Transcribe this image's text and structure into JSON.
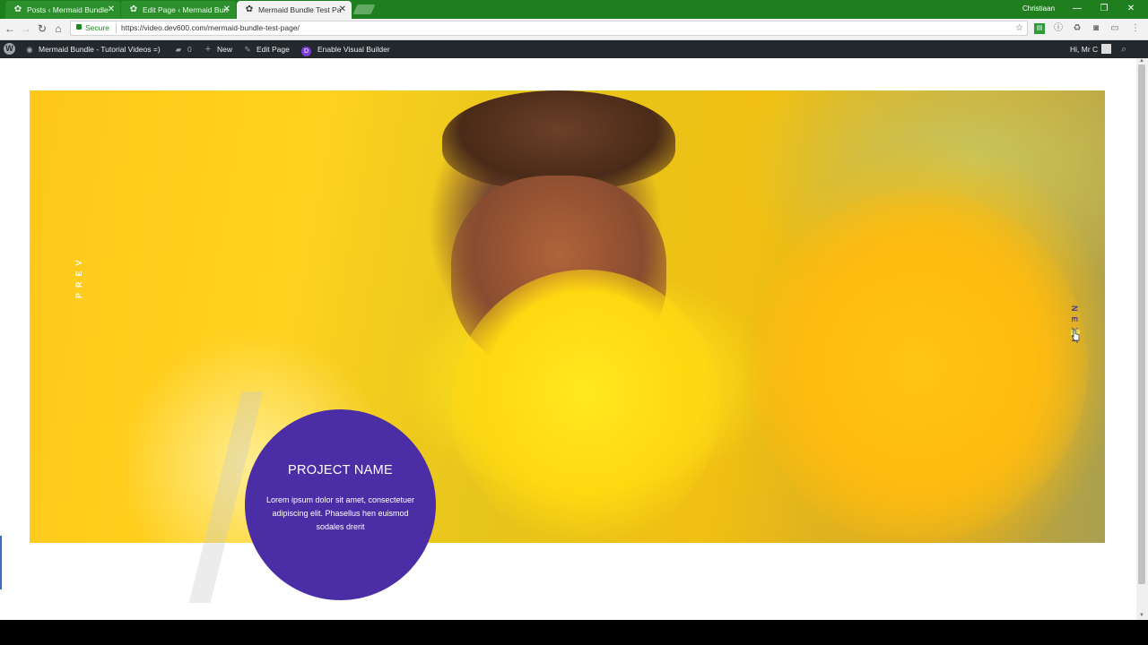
{
  "browser": {
    "tabs": [
      {
        "label": "Posts ‹ Mermaid Bundle",
        "active": false
      },
      {
        "label": "Edit Page ‹ Mermaid Bun",
        "active": false
      },
      {
        "label": "Mermaid Bundle Test Pa",
        "active": true
      }
    ],
    "tab_close": "✕",
    "profile_name": "Christiaan",
    "window_controls": {
      "minimize": "—",
      "maximize": "❐",
      "close": "✕"
    },
    "nav": {
      "back": "←",
      "forward": "→",
      "reload": "↻",
      "home": "⌂"
    },
    "security_label": "Secure",
    "url": "https://video.dev600.com/mermaid-bundle-test-page/",
    "bookmark_star": "☆",
    "extension_icons": [
      "sheet-icon",
      "info-icon",
      "recycle-icon",
      "camera-icon",
      "cast-icon",
      "menu-dots-icon"
    ]
  },
  "adminbar": {
    "site_name": "Mermaid Bundle - Tutorial Videos =)",
    "comments_count": "0",
    "new_label": "New",
    "edit_label": "Edit Page",
    "visual_builder_label": "Enable Visual Builder",
    "greeting": "Hi, Mr C"
  },
  "slider": {
    "prev_label": "PREV",
    "next_label": "NEXT",
    "project_title": "PROJECT NAME",
    "project_text": "Lorem ipsum dolor sit amet, consectetuer adipiscing elit. Phasellus hen euismod sodales drerit",
    "accent_color": "#4b2ea5"
  }
}
